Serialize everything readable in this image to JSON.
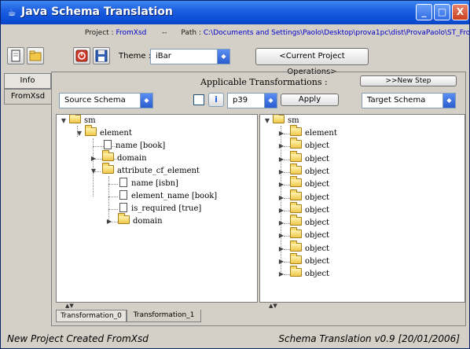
{
  "window": {
    "title": "Java Schema Translation",
    "icon": "java-cup-icon"
  },
  "titlebar_buttons": {
    "minimize": "_",
    "maximize": "□",
    "close": "X"
  },
  "pathbar": {
    "project_label": "Project :",
    "project_value": "FromXsd",
    "separator": "--",
    "path_label": "Path :",
    "path_value": "C:\\Documents and Settings\\Paolo\\Desktop\\prova1pc\\dist\\ProvaPaolo\\ST_Fro"
  },
  "toolbar": {
    "theme_label": "Theme :",
    "theme_value": "iBar",
    "project_ops_label": "<Current Project Operations>",
    "icons": [
      "new-file-icon",
      "open-folder-icon",
      "stop-icon",
      "save-icon"
    ]
  },
  "side_tabs": [
    "Info",
    "FromXsd"
  ],
  "transform": {
    "label": "Applicable Transformations :",
    "new_step_label": ">>New Step",
    "source_schema": "Source Schema",
    "target_schema": "Target Schema",
    "info_symbol": "i",
    "selected_transformation": "p39",
    "apply_label": "Apply"
  },
  "left_tree": {
    "root": "sm",
    "element": "element",
    "name_book": "name [book]",
    "domain": "domain",
    "attr": "attribute_cf_element",
    "name_isbn": "name [isbn]",
    "element_name": "element_name [book]",
    "is_required": "is_required [true]",
    "domain2": "domain"
  },
  "right_tree": {
    "root": "sm",
    "children": [
      "element",
      "object",
      "object",
      "object",
      "object",
      "object",
      "object",
      "object",
      "object",
      "object",
      "object",
      "object"
    ]
  },
  "bottom_tabs": [
    "Transformation_0",
    "Transformation_1"
  ],
  "status": {
    "message": "New Project Created FromXsd",
    "version": "Schema Translation v0.9  [20/01/2006]"
  },
  "colors": {
    "titlebar": "#0b4fd6",
    "link": "#0000c8",
    "folder": "#f1c84a"
  }
}
